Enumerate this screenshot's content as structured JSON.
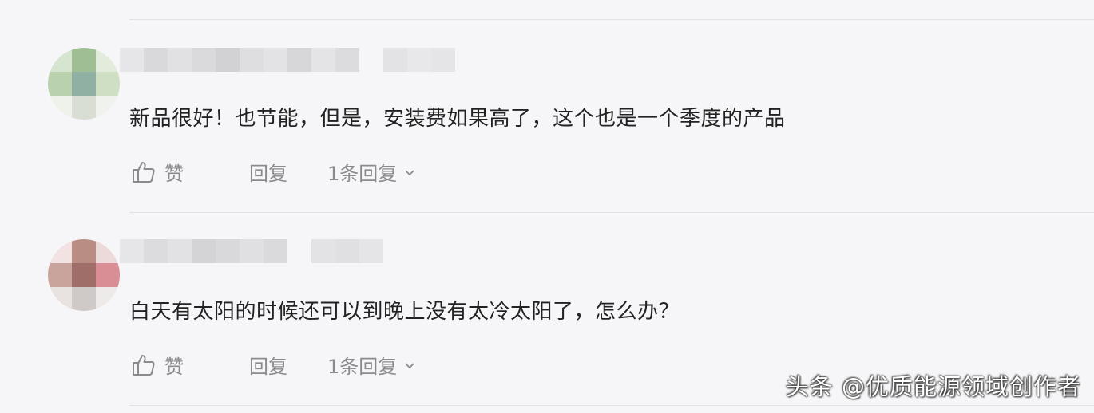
{
  "comments": [
    {
      "text": "新品很好！也节能，但是，安装费如果高了，这个也是一个季度的产品",
      "like_label": "赞",
      "reply_label": "回复",
      "replies_label": "1条回复"
    },
    {
      "text": "白天有太阳的时候还可以到晚上没有太冷太阳了，怎么办？",
      "like_label": "赞",
      "reply_label": "回复",
      "replies_label": "1条回复"
    }
  ],
  "watermark": "头条 @优质能源领域创作者",
  "colors": {
    "background": "#f6f6f8",
    "text": "#222222",
    "muted": "#8b8b8f",
    "divider": "#e2e2e6"
  },
  "icons": {
    "like": "thumbs-up-icon",
    "expand": "chevron-down-icon"
  }
}
